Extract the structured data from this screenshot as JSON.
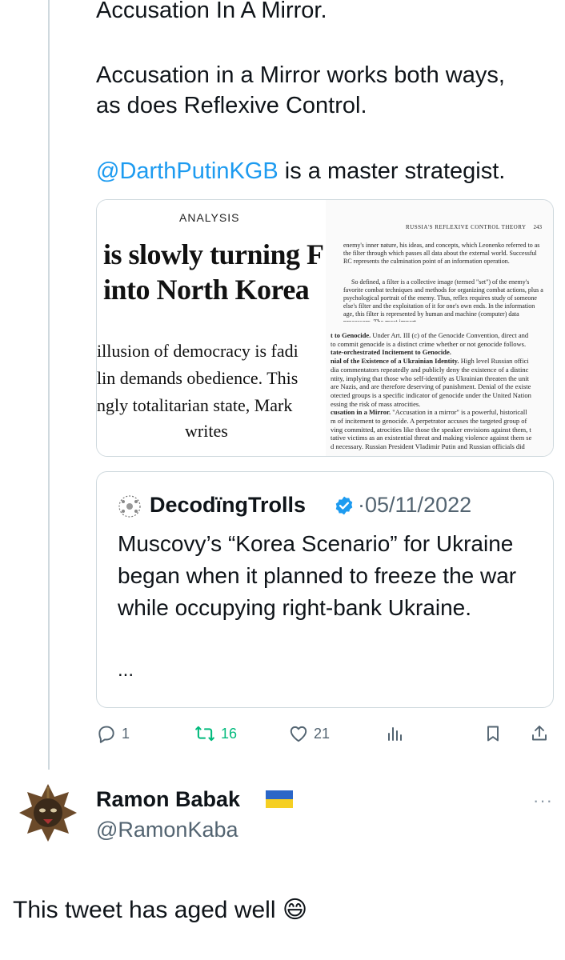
{
  "tweet": {
    "line_top": "Accusation In A Mirror.",
    "para2": [
      "Accusation in a Mirror works both ways,",
      "as does Reflexive Control."
    ],
    "mention": "@DarthPutinKGB",
    "para3_rest": " is a master strategist."
  },
  "media": {
    "analysis_label": "ANALYSIS",
    "headline": [
      "is slowly turning F",
      "into North Korea"
    ],
    "sublines": [
      "illusion of democracy is fadi",
      "lin demands obedience. This",
      "ngly totalitarian state, Mark"
    ],
    "byline": "writes",
    "page_header": "RUSSIA'S REFLEXIVE CONTROL THEORY",
    "page_number": "243",
    "page_paragraph_1": "enemy's inner nature, his ideas, and concepts, which Leonenko referred to as the filter through which passes all data about the external world. Successful RC represents the culmination point of an information operation.",
    "page_paragraph_2": "So defined, a filter is a collective image (termed \"set\") of the enemy's favorite combat techniques and methods for organizing combat actions, plus a psychological portrait of the enemy. Thus, reflex requires study of someone else's filter and the exploitation of it for one's own ends. In the information age, this filter is represented by human and machine (computer) data processors. The most import-",
    "excerpt": [
      {
        "bold": "t to Genocide.",
        "text": " Under Art. III (c) of the Genocide Convention, direct and"
      },
      {
        "bold": "",
        "text": "to commit genocide is a distinct crime whether or not genocide follows."
      },
      {
        "bold": "tate-orchestrated Incitement to Genocide.",
        "text": ""
      },
      {
        "bold": "nial of the Existence of a Ukrainian Identity.",
        "text": " High level Russian offici"
      },
      {
        "bold": "",
        "text": "dia commentators repeatedly and publicly deny the existence of a distinc"
      },
      {
        "bold": "",
        "text": "ntity, implying that those who self-identify as Ukrainian threaten the unit"
      },
      {
        "bold": "",
        "text": "are Nazis, and are therefore deserving of punishment. Denial of the existe"
      },
      {
        "bold": "",
        "text": "otected groups is a specific indicator of genocide under the United Nation"
      },
      {
        "bold": "",
        "text": "essing the risk of mass atrocities."
      },
      {
        "bold": "cusation in a Mirror.",
        "text": " \"Accusation in a mirror\" is a powerful, historicall"
      },
      {
        "bold": "",
        "text": "m of incitement to genocide. A perpetrator accuses the targeted group of"
      },
      {
        "bold": "",
        "text": "ving committed, atrocities like those the speaker envisions against them, t"
      },
      {
        "bold": "",
        "text": "tative victims as an existential threat and making violence against them se"
      },
      {
        "bold": "",
        "text": "d necessary. Russian President Vladimir Putin and Russian officials did"
      }
    ]
  },
  "quote": {
    "name": "DecodïngTrolls",
    "date": "05/11/2022",
    "text": "Muscovy’s “Korea Scenario” for Ukraine began when it planned to freeze the war while occupying right-bank Ukraine.",
    "ellipsis": "..."
  },
  "actions": {
    "reply_count": "1",
    "retweet_count": "16",
    "like_count": "21"
  },
  "reply": {
    "name": "Ramon Babak",
    "handle": "@RamonKaba",
    "more": "···",
    "text": "This tweet has aged well 😄"
  },
  "colors": {
    "link": "#1d9bf0",
    "retweet": "#00ba7c",
    "muted": "#536471",
    "border": "#cfd9de"
  },
  "icons": [
    "reply-icon",
    "retweet-icon",
    "like-icon",
    "analytics-icon",
    "bookmark-icon",
    "share-icon",
    "verified-badge-icon",
    "ukraine-flag-icon",
    "more-icon"
  ]
}
